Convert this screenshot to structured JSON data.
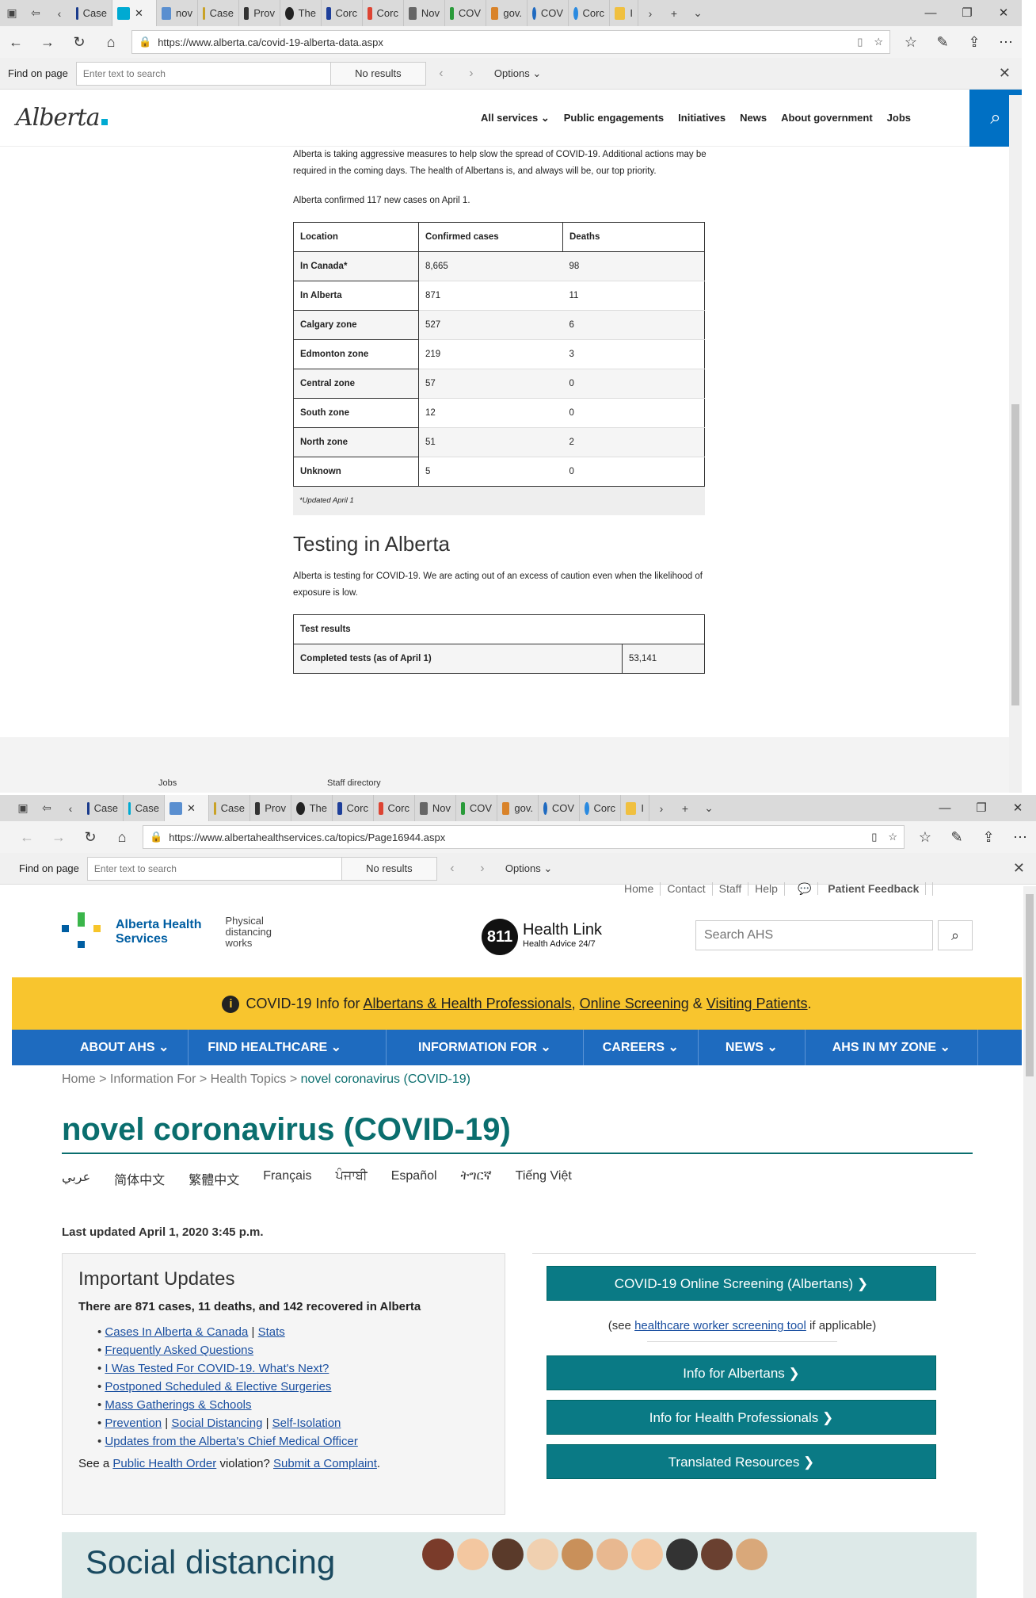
{
  "win1": {
    "tabs": [
      "Case",
      "",
      "nov",
      "Case",
      "Prov",
      "The",
      "Corc",
      "Corc",
      "Nov",
      "COV",
      "gov.",
      "COV",
      "Corc",
      "I"
    ],
    "url": "https://www.alberta.ca/covid-19-alberta-data.aspx",
    "find": {
      "label": "Find on page",
      "placeholder": "Enter text to search",
      "status": "No results",
      "options": "Options"
    },
    "logo": "Alberta",
    "nav": [
      "All services",
      "Public engagements",
      "Initiatives",
      "News",
      "About government",
      "Jobs"
    ],
    "intro": "Alberta is taking aggressive measures to help slow the spread of COVID-19. Additional actions may be required in the coming days. The health of Albertans is, and always will be, our top priority.",
    "confirmed": "Alberta confirmed 117 new cases on April 1.",
    "table": {
      "headers": [
        "Location",
        "Confirmed cases",
        "Deaths"
      ],
      "rows": [
        [
          "In Canada*",
          "8,665",
          "98"
        ],
        [
          "In Alberta",
          "871",
          "11"
        ],
        [
          "Calgary zone",
          "527",
          "6"
        ],
        [
          "Edmonton zone",
          "219",
          "3"
        ],
        [
          "Central zone",
          "57",
          "0"
        ],
        [
          "South zone",
          "12",
          "0"
        ],
        [
          "North zone",
          "51",
          "2"
        ],
        [
          "Unknown",
          "5",
          "0"
        ]
      ],
      "note": "*Updated April 1"
    },
    "testing_title": "Testing in Alberta",
    "testing_text": "Alberta is testing for COVID-19. We are acting out of an excess of caution even when the likelihood of exposure is low.",
    "tests": {
      "header": "Test results",
      "label": "Completed tests (as of April 1)",
      "value": "53,141"
    },
    "footer": [
      "Jobs",
      "Staff directory"
    ]
  },
  "win2": {
    "tabs": [
      "Case",
      "Case",
      "",
      "Case",
      "Prov",
      "The",
      "Corc",
      "Corc",
      "Nov",
      "COV",
      "gov.",
      "COV",
      "Corc",
      "I"
    ],
    "url": "https://www.albertahealthservices.ca/topics/Page16944.aspx",
    "find": {
      "label": "Find on page",
      "placeholder": "Enter text to search",
      "status": "No results",
      "options": "Options"
    },
    "top_links": [
      "Home",
      "Contact",
      "Staff",
      "Help",
      "Patient Feedback"
    ],
    "logo_name": [
      "Alberta Health",
      "Services"
    ],
    "slogan": [
      "Physical",
      "distancing",
      "works"
    ],
    "healthlink": {
      "num": "811",
      "title": "Health Link",
      "sub": "Health Advice 24/7"
    },
    "search_placeholder": "Search AHS",
    "banner": {
      "pre": "COVID-19 Info for ",
      "l1": "Albertans & Health Professionals",
      "sep1": ", ",
      "l2": "Online Screening",
      "sep2": " & ",
      "l3": "Visiting Patients",
      "post": "."
    },
    "menu": [
      "ABOUT AHS ⌄",
      "FIND HEALTHCARE ⌄",
      "INFORMATION FOR ⌄",
      "CAREERS ⌄",
      "NEWS ⌄",
      "AHS IN MY ZONE ⌄"
    ],
    "breadcrumb": {
      "a": "Home",
      "b": "Information For",
      "c": "Health Topics",
      "cur": "novel coronavirus (COVID-19)"
    },
    "title": "novel coronavirus (COVID-19)",
    "languages": [
      "عربي",
      "简体中文",
      "繁體中文",
      "Français",
      "ਪੰਜਾਬੀ",
      "Español",
      "ትግርኛ",
      "Tiếng Việt"
    ],
    "last_updated": "Last updated April 1, 2020 3:45 p.m.",
    "updates": {
      "title": "Important Updates",
      "lead": "There are 871 cases, 11 deaths, and 142 recovered in Alberta",
      "items": [
        [
          "Cases In Alberta & Canada",
          "Stats"
        ],
        [
          "Frequently Asked Questions"
        ],
        [
          "I Was Tested For COVID-19. What's Next?"
        ],
        [
          "Postponed Scheduled & Elective Surgeries"
        ],
        [
          "Mass Gatherings & Schools"
        ],
        [
          "Prevention",
          "Social Distancing",
          "Self-Isolation"
        ],
        [
          "Updates from the Alberta's Chief Medical Officer"
        ]
      ],
      "foot_pre": "See a ",
      "foot_l1": "Public Health Order",
      "foot_mid": " violation? ",
      "foot_l2": "Submit a Complaint",
      "foot_post": "."
    },
    "buttons": {
      "screening": "COVID-19 Online Screening (Albertans) ❯",
      "see_pre": "(see ",
      "see_link": "healthcare worker screening tool",
      "see_post": " if applicable)",
      "albertans": "Info for Albertans ❯",
      "professionals": "Info for Health Professionals ❯",
      "translated": "Translated Resources ❯"
    },
    "social": "Social distancing"
  }
}
